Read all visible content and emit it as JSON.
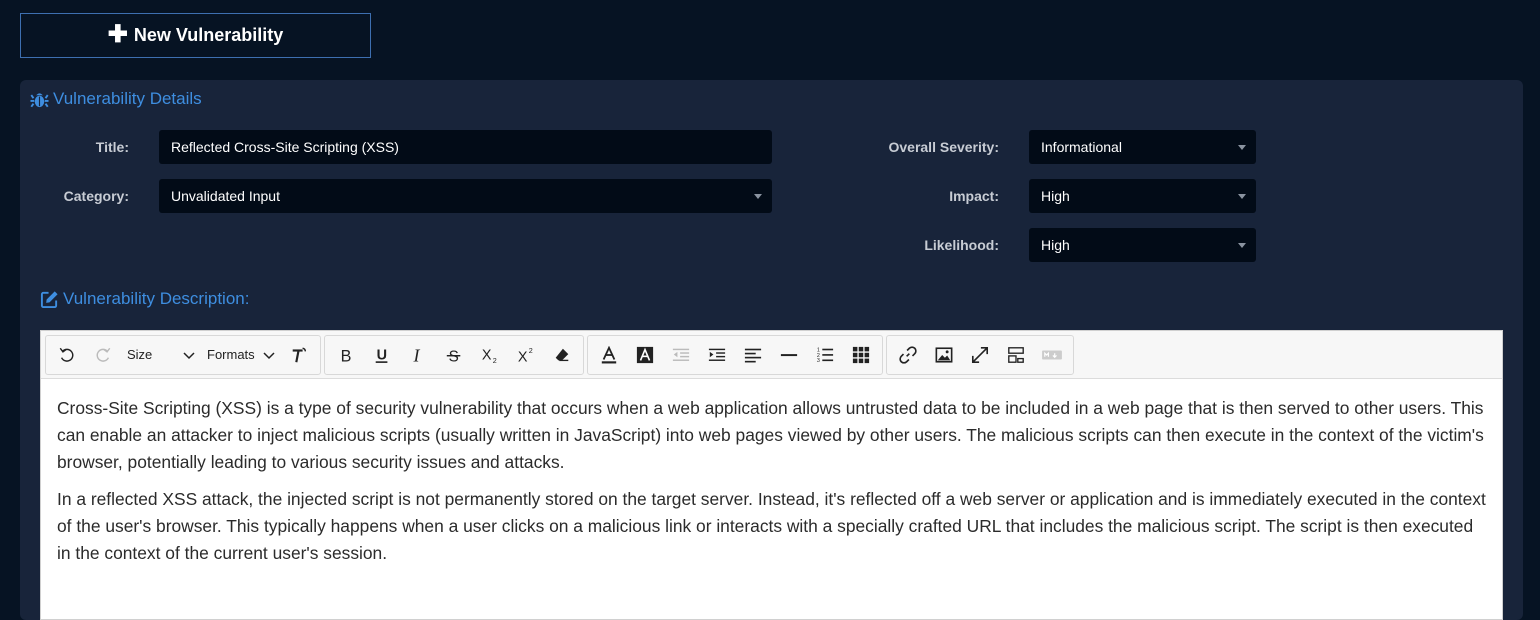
{
  "new_button": {
    "label": "New Vulnerability"
  },
  "details": {
    "heading": "Vulnerability Details",
    "title_label": "Title:",
    "title_value": "Reflected Cross-Site Scripting (XSS)",
    "category_label": "Category:",
    "category_value": "Unvalidated Input",
    "severity_label": "Overall Severity:",
    "severity_value": "Informational",
    "impact_label": "Impact:",
    "impact_value": "High",
    "likelihood_label": "Likelihood:",
    "likelihood_value": "High"
  },
  "description": {
    "heading": "Vulnerability Description:",
    "toolbar": {
      "size_label": "Size",
      "formats_label": "Formats"
    },
    "paragraphs": [
      "Cross-Site Scripting (XSS) is a type of security vulnerability that occurs when a web application allows untrusted data to be included in a web page that is then served to other users. This can enable an attacker to inject malicious scripts (usually written in JavaScript) into web pages viewed by other users. The malicious scripts can then execute in the context of the victim's browser, potentially leading to various security issues and attacks.",
      "In a reflected XSS attack, the injected script is not permanently stored on the target server. Instead, it's reflected off a web server or application and is immediately executed in the context of the user's browser. This typically happens when a user clicks on a malicious link or interacts with a specially crafted URL that includes the malicious script. The script is then executed in the context of the current user's session."
    ]
  },
  "colors": {
    "page_bg": "#061323",
    "panel_bg": "#18243a",
    "field_bg": "#020b17",
    "accent": "#3e8ee0"
  }
}
